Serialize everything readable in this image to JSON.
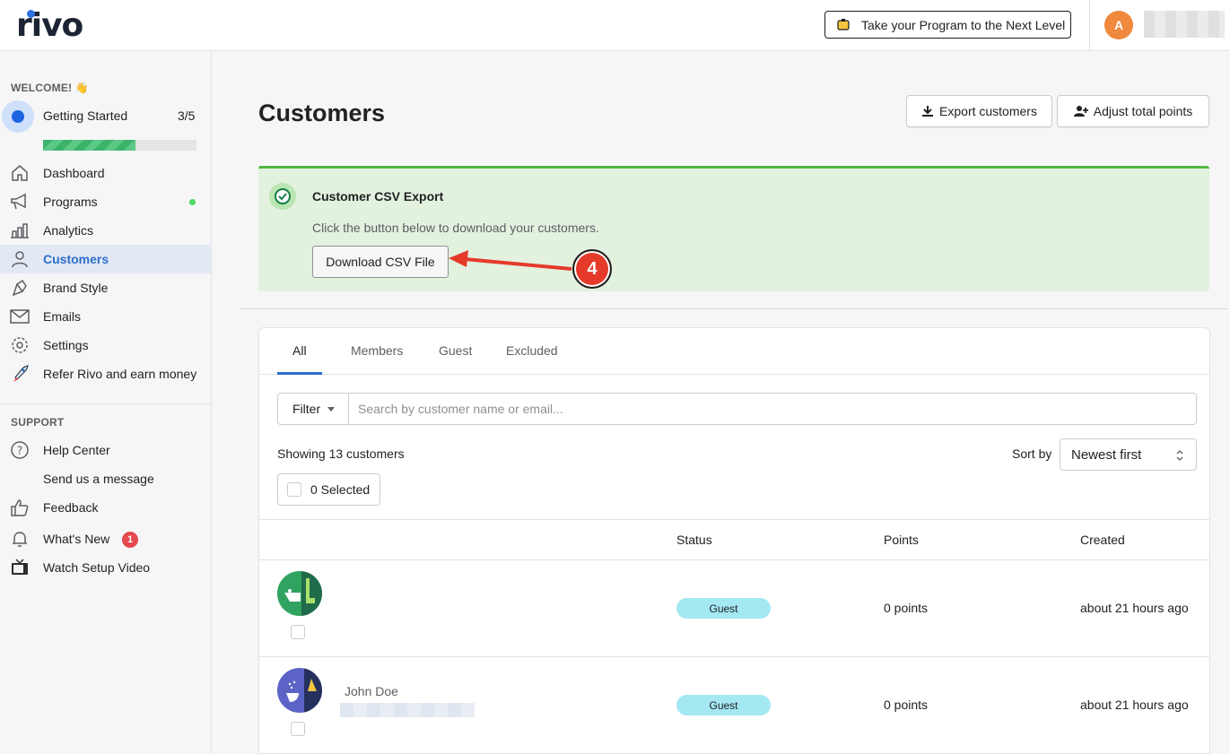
{
  "header": {
    "logo": "rivo",
    "promo_label": "Take your Program to the Next Level",
    "avatar_initial": "A"
  },
  "sidebar": {
    "welcome": "WELCOME! 👋",
    "getting_started": {
      "label": "Getting Started",
      "count": "3/5",
      "progress": 0.6
    },
    "items": [
      {
        "label": "Dashboard",
        "icon": "home-icon"
      },
      {
        "label": "Programs",
        "icon": "megaphone-icon",
        "dot": true
      },
      {
        "label": "Analytics",
        "icon": "bar-chart-icon"
      },
      {
        "label": "Customers",
        "icon": "person-icon",
        "active": true
      },
      {
        "label": "Brand Style",
        "icon": "brush-icon"
      },
      {
        "label": "Emails",
        "icon": "envelope-icon"
      },
      {
        "label": "Settings",
        "icon": "gear-icon"
      },
      {
        "label": "Refer Rivo and earn money",
        "icon": "rocket-icon"
      }
    ],
    "support_heading": "SUPPORT",
    "support_items": [
      {
        "label": "Help Center",
        "icon": "question-icon"
      },
      {
        "label": "Send us a message",
        "icon": ""
      },
      {
        "label": "Feedback",
        "icon": "thumbs-up-icon"
      },
      {
        "label": "What's New",
        "icon": "bell-icon",
        "badge": "1"
      },
      {
        "label": "Watch Setup Video",
        "icon": "tv-icon"
      }
    ]
  },
  "main": {
    "title": "Customers",
    "export_button": "Export customers",
    "adjust_button": "Adjust total points",
    "banner": {
      "title": "Customer CSV Export",
      "text": "Click the button below to download your customers.",
      "button": "Download CSV File"
    },
    "annotation_number": "4",
    "tabs": [
      "All",
      "Members",
      "Guest",
      "Excluded"
    ],
    "filter_label": "Filter",
    "search_placeholder": "Search by customer name or email...",
    "showing_text": "Showing 13 customers",
    "sort_label": "Sort by",
    "sort_value": "Newest first",
    "selected_label": "0 Selected",
    "table": {
      "headers": [
        "Status",
        "Points",
        "Created"
      ],
      "rows": [
        {
          "name": "",
          "status": "Guest",
          "points": "0 points",
          "created": "about 21 hours ago"
        },
        {
          "name": "John Doe",
          "status": "Guest",
          "points": "0 points",
          "created": "about 21 hours ago"
        }
      ]
    }
  }
}
